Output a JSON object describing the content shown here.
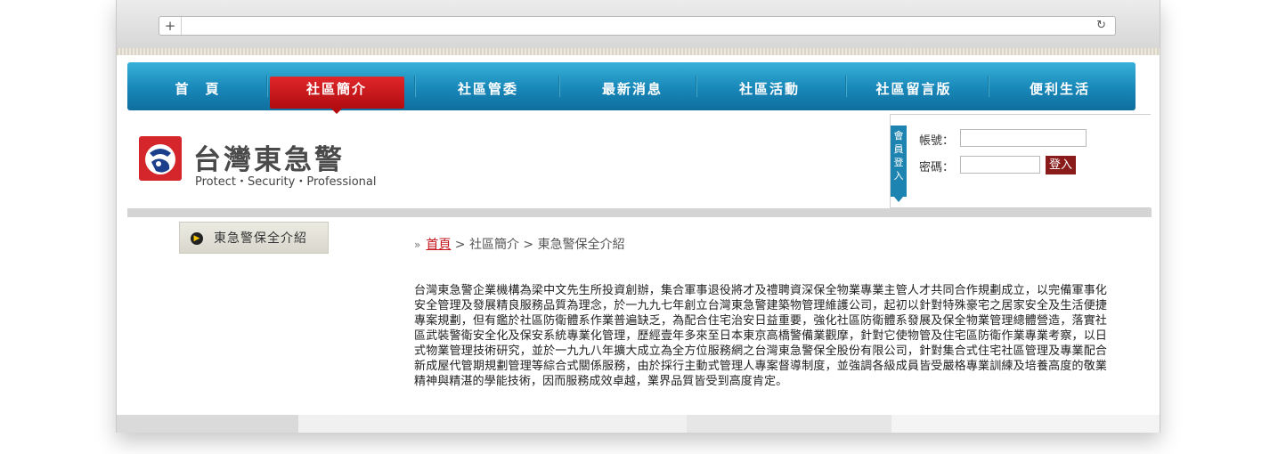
{
  "browser": {
    "new_tab_symbol": "+",
    "reload_symbol": "↻"
  },
  "nav": {
    "items": [
      {
        "label": "首　頁"
      },
      {
        "label": "社區簡介"
      },
      {
        "label": "社區管委"
      },
      {
        "label": "最新消息"
      },
      {
        "label": "社區活動"
      },
      {
        "label": "社區留言版"
      },
      {
        "label": "便利生活"
      }
    ],
    "active_index": 1
  },
  "brand": {
    "name": "台灣東急警",
    "slogan": "Protect・Security・Professional"
  },
  "login": {
    "tab_label": "會員登入",
    "account_label": "帳號：",
    "password_label": "密碼：",
    "submit_label": "登入"
  },
  "sidebar": {
    "item_label": "東急警保全介紹"
  },
  "breadcrumb": {
    "arrow": "»",
    "home": "首頁",
    "rest": " > 社區簡介 > 東急警保全介紹"
  },
  "content": {
    "intro": "台灣東急警企業機構為梁中文先生所投資創辦，集合軍事退役將才及禮聘資深保全物業專業主管人才共同合作規劃成立，以完備軍事化安全管理及發展精良服務品質為理念，於一九九七年創立台灣東急警建築物管理維護公司，起初以針對特殊豪宅之居家安全及生活便捷專案規劃，但有鑑於社區防衛體系作業普遍缺乏，為配合住宅治安日益重要，強化社區防衛體系發展及保全物業管理總體營造，落實社區武裝警衛安全化及保安系統專業化管理，歷經壹年多來至日本東京高橋警備業觀摩，針對它使物管及住宅區防衛作業專業考察，以日式物業管理技術研究，並於一九九八年擴大成立為全方位服務網之台灣東急警保全股份有限公司，針對集合式住宅社區管理及專業配合新成屋代管期規劃管理等綜合式關係服務，由於採行主動式管理人專案督導制度，並強調各級成員皆受嚴格專業訓練及培養高度的敬業精神與精湛的學能技術，因而服務成效卓越，業界品質皆受到高度肯定。"
  },
  "colors": {
    "nav_blue": "#1887b8",
    "nav_active_red": "#c4161c",
    "login_tab_blue": "#1d83b0",
    "login_button": "#8a1b1b"
  }
}
